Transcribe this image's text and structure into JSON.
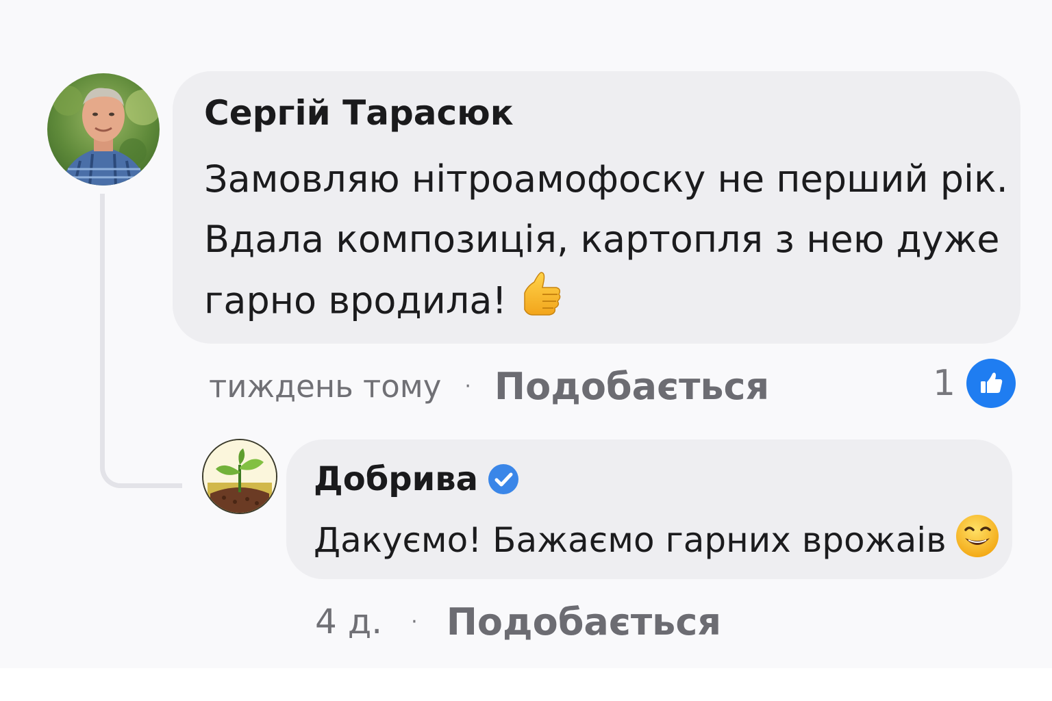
{
  "comment": {
    "author": "Сергій Тарасюк",
    "avatar_icon": "person-photo-avatar",
    "text_lines": [
      "Замовляю нітроамофоску не перший рік.",
      "Вдала композиція, картопля з нею дуже",
      "гарно вродила!"
    ],
    "emoji": "thumbs-up-emoji",
    "timestamp": "тиждень тому",
    "separator": "·",
    "like_label": "Подобається",
    "reaction_count": "1",
    "reaction_icon": "like-icon",
    "reaction_color": "#1f7df1"
  },
  "reply": {
    "author": "Добрива",
    "verified_icon": "verified-badge-icon",
    "verified_color": "#3a86e8",
    "avatar_icon": "sprout-logo-avatar",
    "text": "Дакуємо! Бажаємо гарних врожаів",
    "emoji": "smiling-emoji",
    "timestamp": "4 д.",
    "separator": "·",
    "like_label": "Подобається"
  }
}
